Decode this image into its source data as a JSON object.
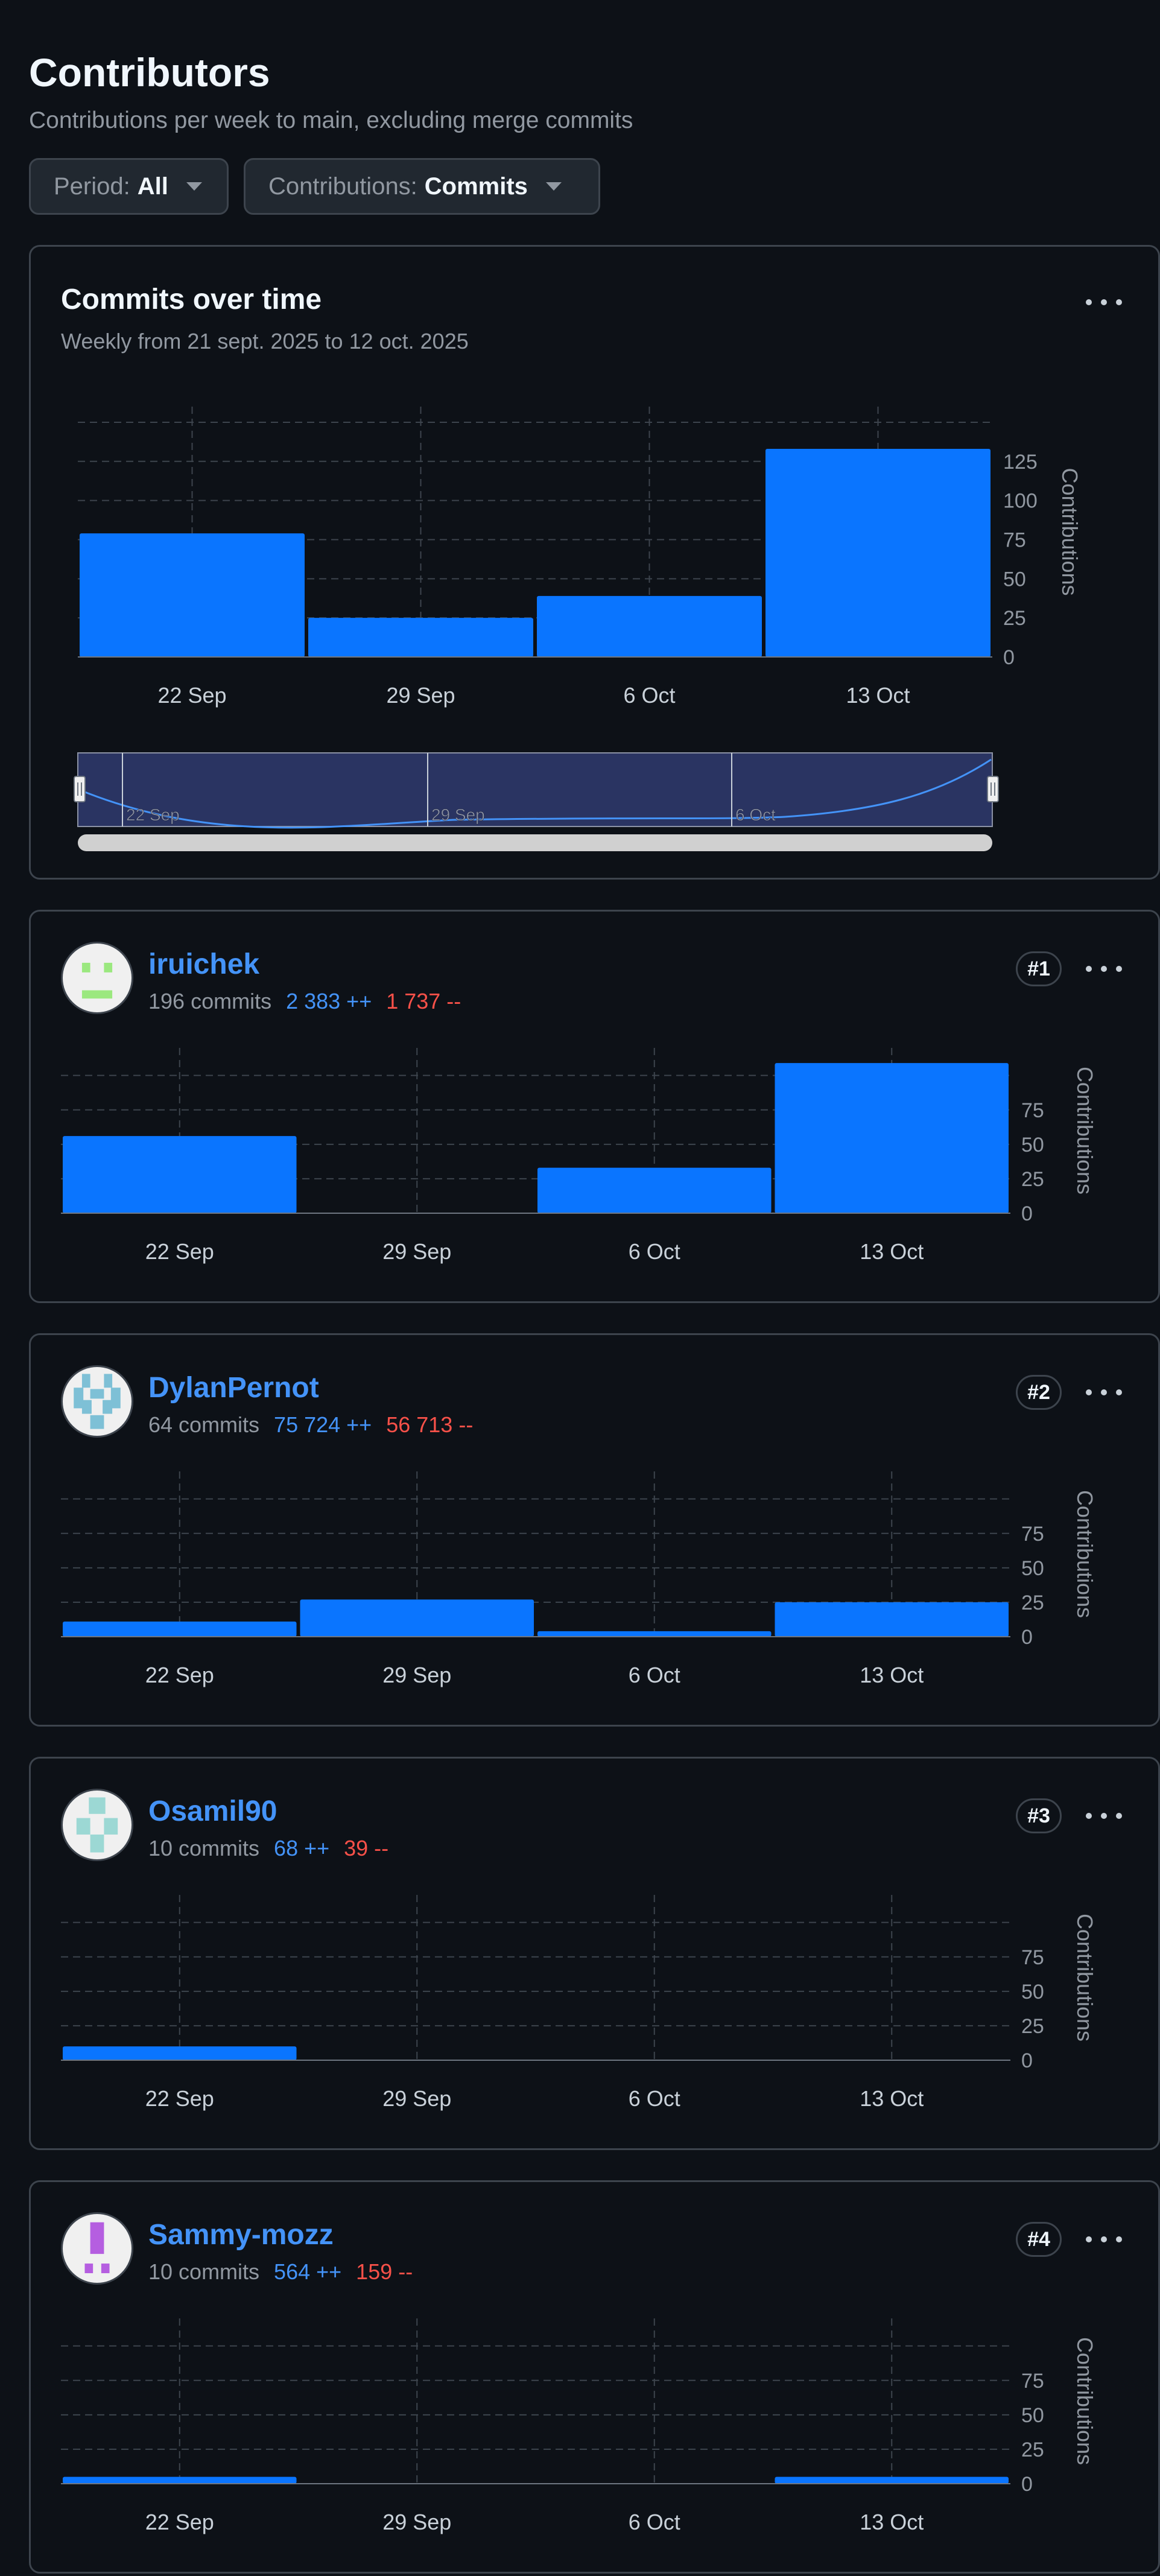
{
  "header": {
    "title": "Contributors",
    "subtitle": "Contributions per week to main, excluding merge commits"
  },
  "filters": {
    "period": {
      "label": "Period:",
      "value": "All"
    },
    "contributions": {
      "label": "Contributions:",
      "value": "Commits"
    }
  },
  "overview": {
    "title": "Commits over time",
    "subtitle": "Weekly from 21 sept. 2025 to 12 oct. 2025",
    "chart_data": {
      "type": "bar",
      "categories": [
        "22 Sep",
        "29 Sep",
        "6 Oct",
        "13 Oct"
      ],
      "values": [
        79,
        25,
        39,
        133
      ],
      "ylabel": "Contributions",
      "yticks": [
        0,
        25,
        50,
        75,
        100,
        125
      ],
      "ylim": [
        0,
        160
      ],
      "xlabel": "",
      "grid": true
    },
    "navigator": {
      "labels": [
        "22 Sep",
        "29 Sep",
        "6 Oct"
      ]
    }
  },
  "contributors": [
    {
      "name": "iruichek",
      "commits": "196 commits",
      "additions": "2 383 ++",
      "deletions": "1 737 --",
      "rank": "#1",
      "avatar": {
        "color": "#9be87f",
        "pattern": "a"
      },
      "chart_data": {
        "type": "bar",
        "categories": [
          "22 Sep",
          "29 Sep",
          "6 Oct",
          "13 Oct"
        ],
        "values": [
          56,
          0,
          33,
          109
        ],
        "ylabel": "Contributions",
        "yticks": [
          0,
          25,
          50,
          75
        ],
        "ylim": [
          0,
          120
        ]
      }
    },
    {
      "name": "DylanPernot",
      "commits": "64 commits",
      "additions": "75 724 ++",
      "deletions": "56 713 --",
      "rank": "#2",
      "avatar": {
        "color": "#7ec0d6",
        "pattern": "b"
      },
      "chart_data": {
        "type": "bar",
        "categories": [
          "22 Sep",
          "29 Sep",
          "6 Oct",
          "13 Oct"
        ],
        "values": [
          11,
          27,
          4,
          25
        ],
        "ylabel": "Contributions",
        "yticks": [
          0,
          25,
          50,
          75
        ],
        "ylim": [
          0,
          120
        ]
      }
    },
    {
      "name": "Osamil90",
      "commits": "10 commits",
      "additions": "68 ++",
      "deletions": "39 --",
      "rank": "#3",
      "avatar": {
        "color": "#9cd8d4",
        "pattern": "c"
      },
      "chart_data": {
        "type": "bar",
        "categories": [
          "22 Sep",
          "29 Sep",
          "6 Oct",
          "13 Oct"
        ],
        "values": [
          10,
          0,
          0,
          0
        ],
        "ylabel": "Contributions",
        "yticks": [
          0,
          25,
          50,
          75
        ],
        "ylim": [
          0,
          120
        ]
      }
    },
    {
      "name": "Sammy-mozz",
      "commits": "10 commits",
      "additions": "564 ++",
      "deletions": "159 --",
      "rank": "#4",
      "avatar": {
        "color": "#b55ee0",
        "pattern": "d"
      },
      "chart_data": {
        "type": "bar",
        "categories": [
          "22 Sep",
          "29 Sep",
          "6 Oct",
          "13 Oct"
        ],
        "values": [
          5,
          0,
          0,
          5
        ],
        "ylabel": "Contributions",
        "yticks": [
          0,
          25,
          50,
          75
        ],
        "ylim": [
          0,
          120
        ]
      }
    }
  ],
  "colors": {
    "bar": "#0a75ff",
    "accent": "#4493f8",
    "danger": "#f85149",
    "background": "#0d1117",
    "border": "#3d444d"
  }
}
